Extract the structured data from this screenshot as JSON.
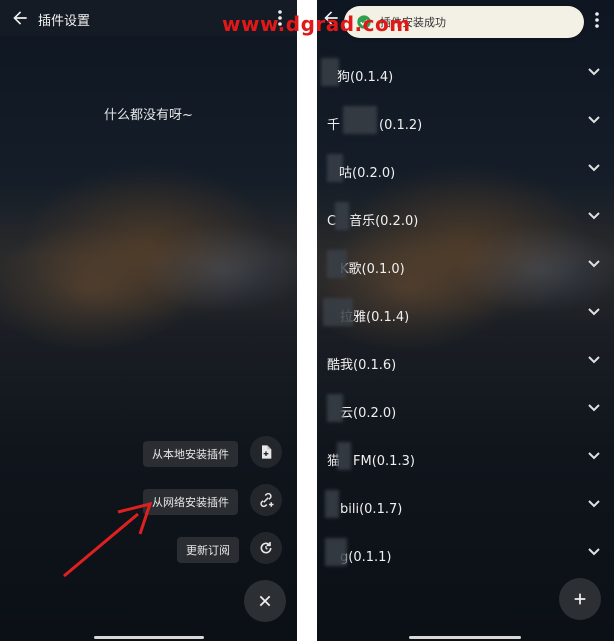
{
  "left_screen": {
    "title": "插件设置",
    "empty_message": "什么都没有呀~",
    "actions": [
      {
        "label": "从本地安装插件",
        "icon": "file-add-icon"
      },
      {
        "label": "从网络安装插件",
        "icon": "link-add-icon"
      },
      {
        "label": "更新订阅",
        "icon": "refresh-icon"
      }
    ],
    "close_icon": "close-icon"
  },
  "watermark": "www.dgrad.com",
  "right_screen": {
    "toast": "插件安装成功",
    "plugins": [
      {
        "name": "狗(0.1.4)"
      },
      {
        "name": "千　　　(0.1.2)"
      },
      {
        "name": "咕(0.2.0)"
      },
      {
        "name": "C　音乐(0.2.0)"
      },
      {
        "name": "　K歌(0.1.0)"
      },
      {
        "name": "　拉雅(0.1.4)"
      },
      {
        "name": "酷我(0.1.6)"
      },
      {
        "name": "　云(0.2.0)"
      },
      {
        "name": "猫　FM(0.1.3)"
      },
      {
        "name": "　bili(0.1.7)"
      },
      {
        "name": "　g(0.1.1)"
      }
    ],
    "add_icon": "plus-icon"
  },
  "colors": {
    "watermark": "#e01818",
    "arrow": "#e02020",
    "accent_check": "#2e9e4f"
  }
}
